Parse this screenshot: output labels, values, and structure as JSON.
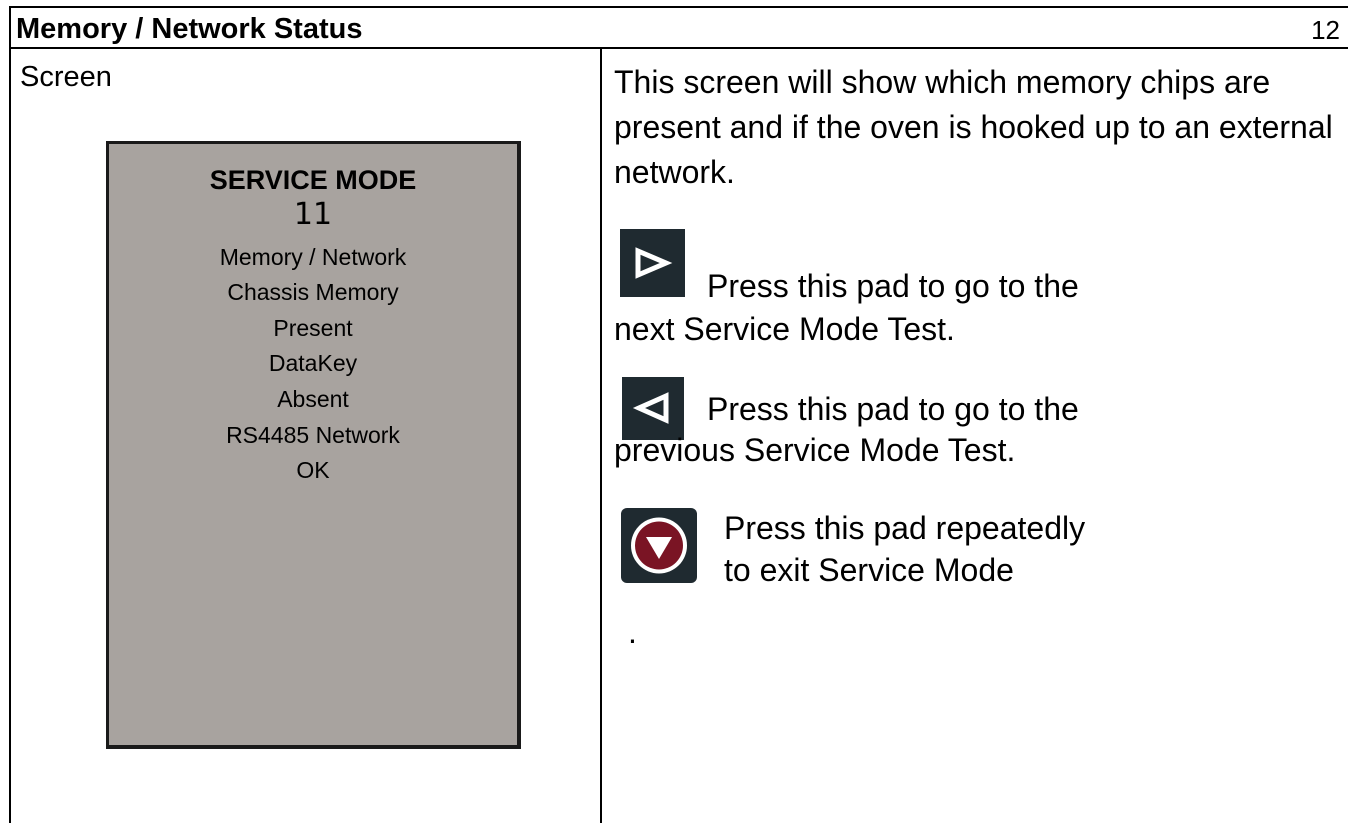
{
  "header": {
    "title": "Memory / Network Status",
    "page_number": "12"
  },
  "left": {
    "label": "Screen",
    "display": {
      "title": "SERVICE MODE",
      "number": "11",
      "lines": [
        "Memory / Network",
        "Chassis Memory",
        "Present",
        "DataKey",
        "Absent",
        "RS4485 Network",
        "OK"
      ],
      "background_color": "#a8a39f"
    }
  },
  "right": {
    "intro": "This screen will show which memory chips are present and if the oven is hooked up to an external network.",
    "next": {
      "icon": "play-right-icon",
      "line1": "Press this pad to go to the",
      "line2": "next Service Mode Test."
    },
    "previous": {
      "icon": "play-left-icon",
      "line1": "Press this pad to go to the",
      "line2": "previous Service Mode Test."
    },
    "exit": {
      "icon": "down-circle-icon",
      "line1": "Press this pad repeatedly",
      "line2": "to exit Service Mode"
    },
    "trailing": "."
  },
  "colors": {
    "pad_background": "#1f2a30",
    "exit_accent": "#7a1424"
  }
}
